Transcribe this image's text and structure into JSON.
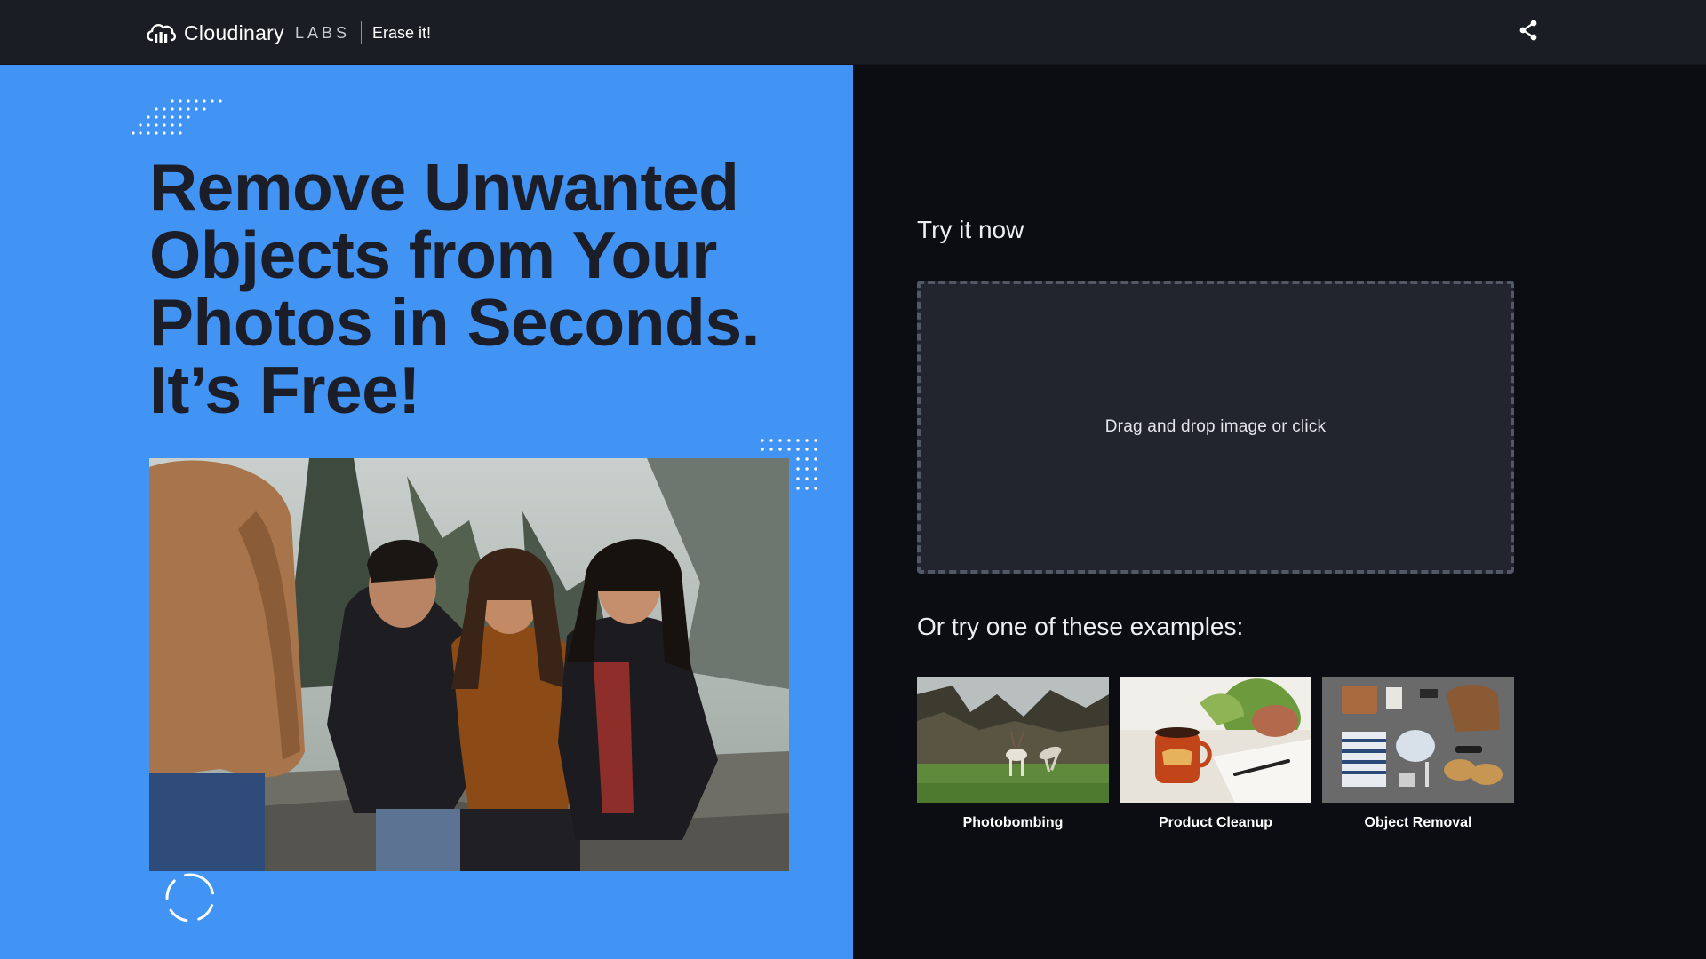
{
  "header": {
    "brand_name": "Cloudinary",
    "brand_sub": "LABS",
    "product_name": "Erase it!",
    "logo_icon": "cloudinary-cloud-icon",
    "share_icon": "share-icon"
  },
  "hero": {
    "title_lines": [
      "Remove Unwanted",
      "Objects from Your",
      "Photos in Seconds.",
      "It’s Free!"
    ],
    "background_color": "#4194f4",
    "title_color": "#1b1e28"
  },
  "upload": {
    "heading": "Try it now",
    "dropzone_text": "Drag and drop image or click"
  },
  "examples": {
    "heading": "Or try one of these examples:",
    "items": [
      {
        "label": "Photobombing",
        "thumb": "deer-in-field"
      },
      {
        "label": "Product Cleanup",
        "thumb": "coffee-mug-notebook"
      },
      {
        "label": "Object Removal",
        "thumb": "flatlay-accessories"
      }
    ]
  },
  "colors": {
    "topbar": "#1a1d23",
    "right_panel": "#0b0d12",
    "dropzone_bg": "#22252e",
    "dropzone_border": "#535866"
  }
}
